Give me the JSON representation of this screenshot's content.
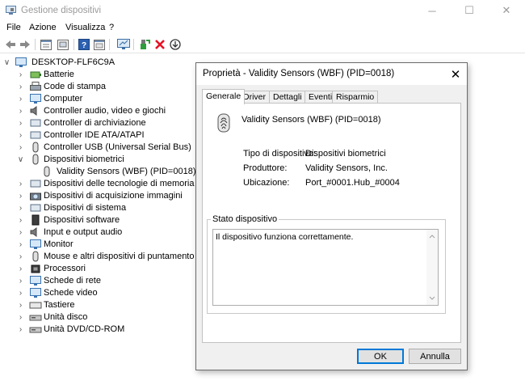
{
  "window": {
    "title": "Gestione dispositivi",
    "minimize": "─",
    "maximize": "☐",
    "close": "✕"
  },
  "menu": [
    "File",
    "Azione",
    "Visualizza",
    "?"
  ],
  "tree": {
    "root": "DESKTOP-FLF6C9A",
    "categories": [
      {
        "label": "Batterie",
        "expanded": false
      },
      {
        "label": "Code di stampa",
        "expanded": false
      },
      {
        "label": "Computer",
        "expanded": false
      },
      {
        "label": "Controller audio, video e giochi",
        "expanded": false
      },
      {
        "label": "Controller di archiviazione",
        "expanded": false
      },
      {
        "label": "Controller IDE ATA/ATAPI",
        "expanded": false
      },
      {
        "label": "Controller USB (Universal Serial Bus)",
        "expanded": false
      },
      {
        "label": "Dispositivi biometrici",
        "expanded": true,
        "children": [
          "Validity Sensors (WBF) (PID=0018)"
        ]
      },
      {
        "label": "Dispositivi delle tecnologie di memoria",
        "expanded": false
      },
      {
        "label": "Dispositivi di acquisizione immagini",
        "expanded": false
      },
      {
        "label": "Dispositivi di sistema",
        "expanded": false
      },
      {
        "label": "Dispositivi software",
        "expanded": false
      },
      {
        "label": "Input e output audio",
        "expanded": false
      },
      {
        "label": "Monitor",
        "expanded": false
      },
      {
        "label": "Mouse e altri dispositivi di puntamento",
        "expanded": false
      },
      {
        "label": "Processori",
        "expanded": false
      },
      {
        "label": "Schede di rete",
        "expanded": false
      },
      {
        "label": "Schede video",
        "expanded": false
      },
      {
        "label": "Tastiere",
        "expanded": false
      },
      {
        "label": "Unità disco",
        "expanded": false
      },
      {
        "label": "Unità DVD/CD-ROM",
        "expanded": false
      }
    ]
  },
  "dialog": {
    "title": "Proprietà - Validity Sensors (WBF) (PID=0018)",
    "close": "✕",
    "tabs": [
      "Generale",
      "Driver",
      "Dettagli",
      "Eventi",
      "Risparmio energia"
    ],
    "active_tab": "Generale",
    "device_name": "Validity Sensors (WBF) (PID=0018)",
    "properties": [
      {
        "label": "Tipo di dispositivo:",
        "value": "Dispositivi biometrici"
      },
      {
        "label": "Produttore:",
        "value": "Validity Sensors, Inc."
      },
      {
        "label": "Ubicazione:",
        "value": "Port_#0001.Hub_#0004"
      }
    ],
    "status_label": "Stato dispositivo",
    "status_text": "Il dispositivo funziona correttamente.",
    "ok_label": "OK",
    "cancel_label": "Annulla"
  },
  "colors": {
    "accent": "#0078d7",
    "red_x": "#e81123",
    "green": "#2e9e3a"
  },
  "icons": {
    "toolbar": [
      "back-arrow-icon",
      "forward-arrow-icon",
      "properties-window-icon",
      "update-driver-icon",
      "help-icon",
      "show-hidden-icon",
      "monitor-scan-icon",
      "add-driver-icon",
      "remove-x-icon",
      "download-circle-icon"
    ]
  }
}
